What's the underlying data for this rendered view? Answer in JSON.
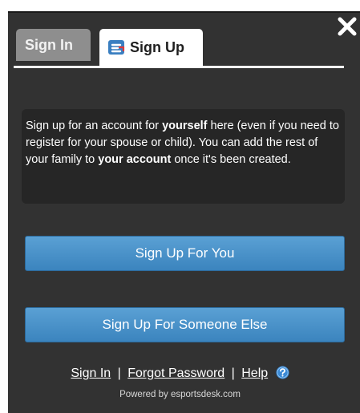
{
  "tabs": {
    "signin_label": "Sign In",
    "signup_label": "Sign Up"
  },
  "info": {
    "text_1": "Sign up for an account for ",
    "bold_1": "yourself",
    "text_2": " here (even if you need to register for your spouse or child). You can add the rest of your family to ",
    "bold_2": "your account",
    "text_3": " once it's been created."
  },
  "buttons": {
    "signup_you": "Sign Up For You",
    "signup_else": "Sign Up For Someone Else"
  },
  "footer": {
    "signin_link": "Sign In",
    "sep1": "|",
    "forgot_link": "Forgot Password",
    "sep2": "|",
    "help_link": "Help",
    "powered": "Powered by esportsdesk.com"
  },
  "icons": {
    "close": "close-icon",
    "logo": "esportsdesk-logo-icon",
    "help": "help-question-icon"
  },
  "colors": {
    "panel_bg": "#323232",
    "button_blue": "#4a93cb",
    "tab_inactive": "#8e8e8e",
    "logo_blue": "#3a7fc1",
    "logo_red": "#e03a3a"
  }
}
